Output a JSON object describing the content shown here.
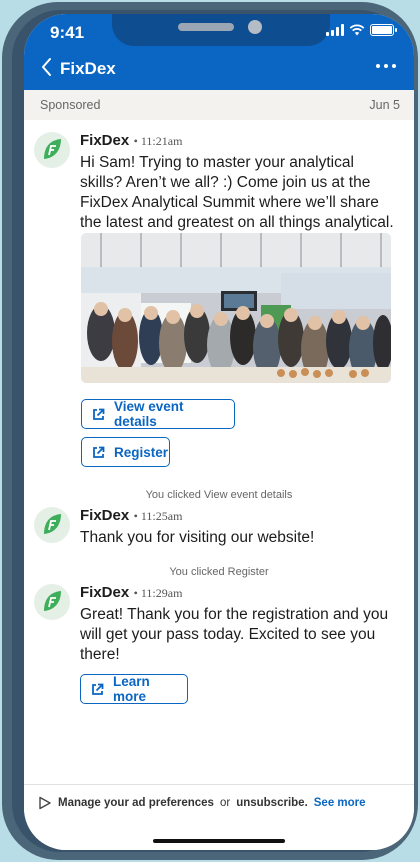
{
  "status": {
    "time": "9:41"
  },
  "header": {
    "title": "FixDex",
    "back_icon": "chevron-left-icon",
    "menu_icon": "more-horizontal-icon",
    "color": "#0a66c2"
  },
  "sponsored": {
    "label": "Sponsored",
    "date": "Jun 5"
  },
  "messages": [
    {
      "sender": "FixDex",
      "time": "• 11:21am",
      "text": "Hi Sam! Trying to master your analytical skills? Aren’t we all? :) Come join us at the FixDex Analytical Summit where we’ll share the latest and greatest on all things analytical."
    },
    {
      "sender": "FixDex",
      "time": "• 11:25am",
      "text": "Thank you for visiting our website!"
    },
    {
      "sender": "FixDex",
      "time": "• 11:29am",
      "text": "Great! Thank you for the registration and you will get your pass today. Excited to see you there!"
    }
  ],
  "buttons": {
    "view_event": "View event details",
    "register": "Register",
    "learn_more": "Learn more",
    "icon": "external-link-icon"
  },
  "notes": {
    "clicked_view": "You clicked View event details",
    "clicked_register": "You clicked Register"
  },
  "footer": {
    "manage": "Manage your ad preferences",
    "or": "or",
    "unsubscribe": "unsubscribe.",
    "see_more": "See more"
  }
}
